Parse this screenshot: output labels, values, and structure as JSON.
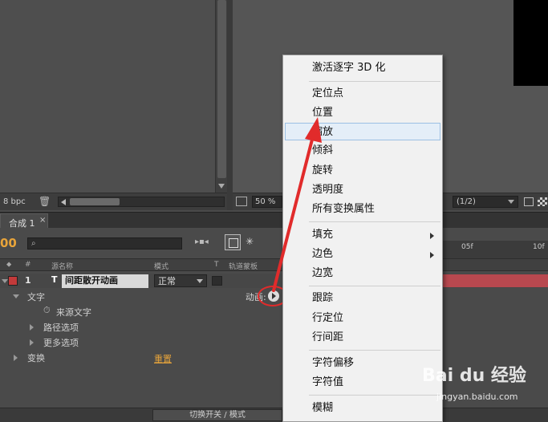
{
  "viewer_left": {
    "bpc": "8 bpc"
  },
  "viewer_right": {
    "zoom": "50 %",
    "resolution": "(1/2)"
  },
  "timeline": {
    "tab_label": "合成 1",
    "tab_close": "×",
    "timecode": "00",
    "ruler_ticks": [
      "05f",
      "10f"
    ],
    "columns": {
      "hash": "#",
      "source_name": "源名称",
      "mode": "模式",
      "t": "T",
      "track_matte": "轨道蒙板"
    },
    "layer": {
      "number": "1",
      "type_glyph": "T",
      "name": "间距散开动画",
      "mode": "正常"
    },
    "props": {
      "text": "文字",
      "animate_label": "动画:",
      "source_text": "来源文字",
      "path_options": "路径选项",
      "more_options": "更多选项",
      "transform": "变换",
      "reset": "重置"
    },
    "bottom_toggle": "切换开关 / 模式"
  },
  "context_menu": {
    "items": [
      {
        "label": "激活逐字 3D 化"
      },
      {
        "label": "定位点"
      },
      {
        "label": "位置"
      },
      {
        "label": "缩放"
      },
      {
        "label": "倾斜"
      },
      {
        "label": "旋转"
      },
      {
        "label": "透明度"
      },
      {
        "label": "所有变换属性"
      },
      {
        "label": "填充"
      },
      {
        "label": "边色"
      },
      {
        "label": "边宽"
      },
      {
        "label": "跟踪"
      },
      {
        "label": "行定位"
      },
      {
        "label": "行间距"
      },
      {
        "label": "字符偏移"
      },
      {
        "label": "字符值"
      },
      {
        "label": "模糊"
      }
    ]
  },
  "watermark": {
    "main": "Bai du 经验",
    "sub": "jingyan.baidu.com"
  },
  "colors": {
    "accent": "#e8a43a",
    "layer_label": "#c23a3a",
    "annotation": "#e12b2b",
    "menu_hover": "#e4eef8"
  }
}
